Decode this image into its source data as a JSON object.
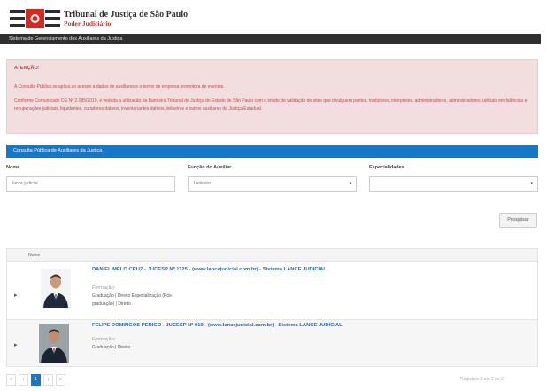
{
  "header": {
    "title": "Tribunal de Justiça de São Paulo",
    "subtitle": "Poder Judiciário"
  },
  "system_bar": {
    "label": "Sistema de Gerenciamento dos Auxiliares da Justiça"
  },
  "alert": {
    "title": "ATENÇÃO:",
    "line1": "A Consulta Pública se aplica ao acesso a dados de auxiliares e o termo de empresa promotora de eventos.",
    "line2": "Conforme Comunicado CG Nº 2.085/2019, é vedada a utilização da Bandeira Tribunal de Justiça do Estado de São Paulo com o intuito de validação de sites que divulguem peritos, tradutores, intérpretes, administradores, administradores judiciais em falências e recuperações judiciais, liquidantes, curadores dativos, inventariantes dativos, leiloeiros e outros auxiliares da Justiça Estadual."
  },
  "panel": {
    "title": "Consulta Pública de Auxiliares da Justiça"
  },
  "form": {
    "name_label": "Nome",
    "name_value": "lance judicial",
    "function_label": "Função do Auxiliar",
    "function_value": "Leiloeiro",
    "specialties_label": "Especialidades",
    "specialties_value": "",
    "search_button": "Pesquisar"
  },
  "table": {
    "column_name": "Nome",
    "rows": [
      {
        "name": "DANIEL MELO CRUZ - JUCESP Nº 1125 - (www.lancejudicial.com.br) - Sistema LANCE JUDICIAL",
        "formation_label": "Formação:",
        "formation_line1": "Graduação | Direito Especialização (Pós-",
        "formation_line2": "graduação) | Direito"
      },
      {
        "name": "FELIPE DOMINGOS PERIGO - JUCESP Nº 919 - (www.lancejudicial.com.br) - Sistema LANCE JUDICIAL",
        "formation_label": "Formação:",
        "formation_line1": "Graduação | Direito"
      }
    ]
  },
  "pagination": {
    "first": "«",
    "prev": "‹",
    "current": "1",
    "next": "›",
    "last": "»",
    "records": "Registros 1 até 2 de 2"
  },
  "colors": {
    "primary": "#1677c8",
    "alert_bg": "#f2dede",
    "alert_text": "#b94a48",
    "dark_bar": "#2f2f2f",
    "link": "#2b67a8"
  }
}
